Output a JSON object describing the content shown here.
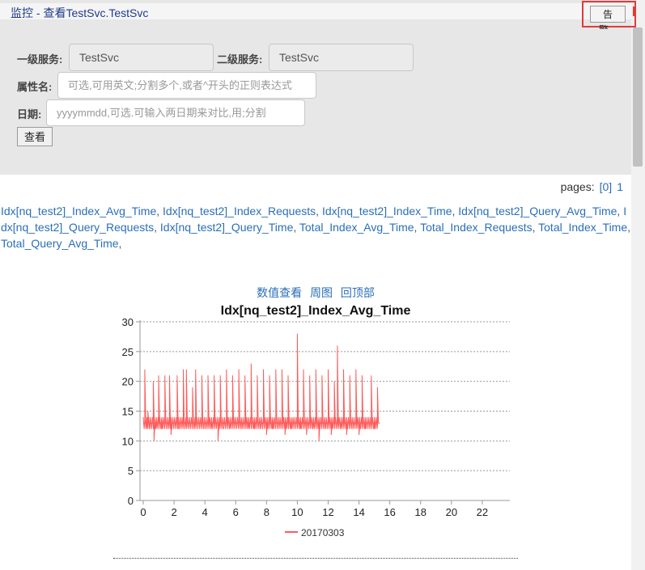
{
  "header": {
    "breadcrumb": "监控 - 查看TestSvc.TestSvc",
    "alarm_label": "告警..."
  },
  "form": {
    "level1_label": "一级服务:",
    "level1_value": "TestSvc",
    "level2_label": "二级服务:",
    "level2_value": "TestSvc",
    "attr_label": "属性名:",
    "attr_placeholder": "可选,可用英文;分割多个,或者^开头的正则表达式",
    "date_label": "日期:",
    "date_placeholder": "yyyymmdd,可选.可输入两日期来对比,用;分割",
    "query_label": "查看"
  },
  "pagination": {
    "label": "pages:",
    "items": [
      "[0]",
      "1"
    ]
  },
  "metrics": [
    "Idx[nq_test2]_Index_Avg_Time",
    "Idx[nq_test2]_Index_Requests",
    "Idx[nq_test2]_Index_Time",
    "Idx[nq_test2]_Query_Avg_Time",
    "Idx[nq_test2]_Query_Requests",
    "Idx[nq_test2]_Query_Time",
    "Total_Index_Avg_Time",
    "Total_Index_Requests",
    "Total_Index_Time",
    "Total_Query_Avg_Time"
  ],
  "chart_actions": [
    "数值查看",
    "周图",
    "回顶部"
  ],
  "colors": {
    "series": "#ff5a5a",
    "link": "#2a6fb7",
    "alarm_border": "#e23a3a"
  },
  "chart_data": {
    "type": "line",
    "title": "Idx[nq_test2]_Index_Avg_Time",
    "xlabel": "",
    "ylabel": "",
    "xlim": [
      0,
      24
    ],
    "ylim": [
      0,
      30
    ],
    "xticks": [
      0,
      2,
      4,
      6,
      8,
      10,
      12,
      14,
      16,
      18,
      20,
      22
    ],
    "yticks": [
      0,
      5,
      10,
      15,
      20,
      25,
      30
    ],
    "grid": true,
    "legend_position": "bottom",
    "baseline": 13,
    "series": [
      {
        "name": "20170303",
        "x": [
          0.0,
          0.1,
          0.2,
          0.3,
          0.4,
          0.6,
          0.65,
          0.7,
          0.8,
          1.0,
          1.2,
          1.4,
          1.6,
          1.7,
          1.8,
          2.0,
          2.2,
          2.3,
          2.5,
          2.6,
          2.7,
          2.8,
          3.0,
          3.2,
          3.3,
          3.4,
          3.6,
          3.8,
          4.0,
          4.2,
          4.4,
          4.6,
          4.8,
          4.85,
          5.0,
          5.2,
          5.4,
          5.6,
          5.8,
          6.0,
          6.2,
          6.4,
          6.6,
          6.8,
          7.0,
          7.2,
          7.4,
          7.6,
          7.8,
          8.0,
          8.2,
          8.4,
          8.6,
          8.8,
          9.0,
          9.2,
          9.4,
          9.6,
          9.8,
          10.0,
          10.2,
          10.4,
          10.6,
          10.8,
          11.0,
          11.2,
          11.4,
          11.6,
          11.8,
          12.0,
          12.2,
          12.4,
          12.6,
          12.8,
          13.0,
          13.2,
          13.4,
          13.6,
          13.8,
          14.0,
          14.2,
          14.4,
          14.6,
          14.8,
          15.0,
          15.2,
          15.3
        ],
        "values": [
          13,
          22,
          12,
          15,
          12,
          13,
          20,
          10,
          12,
          21,
          12,
          21,
          12,
          21,
          11,
          13,
          21,
          12,
          13,
          22,
          12,
          22,
          13,
          19,
          12,
          22,
          13,
          21,
          12,
          21,
          12,
          21,
          13,
          10,
          21,
          12,
          22,
          12,
          21,
          13,
          22,
          12,
          21,
          12,
          23,
          12,
          21,
          12,
          22,
          11,
          21,
          12,
          22,
          13,
          22,
          11,
          21,
          12,
          13,
          28,
          12,
          22,
          11,
          21,
          12,
          22,
          10,
          21,
          12,
          22,
          11,
          20,
          26,
          12,
          22,
          11,
          21,
          12,
          22,
          11,
          21,
          12,
          13,
          21,
          12,
          19,
          13
        ]
      }
    ]
  }
}
